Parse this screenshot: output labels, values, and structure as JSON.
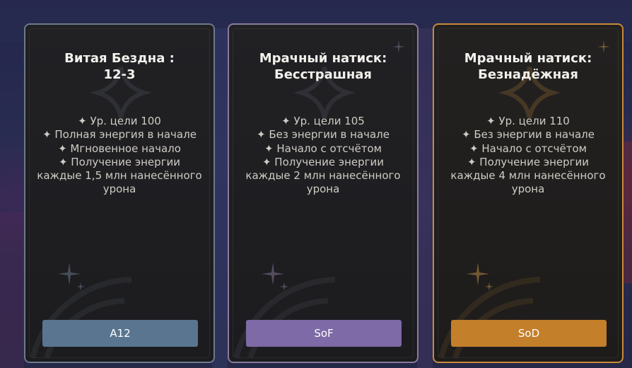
{
  "colors": {
    "a12_accent": "#5a7590",
    "sof_accent": "#7d6aa6",
    "sod_accent": "#c47f2a",
    "card_background": "#1e1e21",
    "title_text": "#f3f1ec",
    "rule_text": "#cfcbc4"
  },
  "cards": [
    {
      "id": "a12",
      "title": "Витая Бездна :\n12-3",
      "emblem_icon": "four-point-star-icon",
      "rules": [
        "✦ Ур. цели 100",
        "✦ Полная энергия в начале",
        "✦ Мгновенное начало",
        "✦ Получение энергии каждые 1,5 млн нанесённого урона"
      ],
      "button_label": "A12"
    },
    {
      "id": "sof",
      "title": "Мрачный натиск:\nБесстрашная",
      "emblem_icon": "four-point-star-icon",
      "rules": [
        "✦ Ур. цели 105",
        "✦ Без энергии в начале",
        "✦ Начало с отсчётом",
        "✦ Получение энергии каждые 2 млн нанесённого урона"
      ],
      "button_label": "SoF"
    },
    {
      "id": "sod",
      "title": "Мрачный натиск:\nБезнадёжная",
      "emblem_icon": "four-point-star-icon",
      "rules": [
        "✦ Ур. цели 110",
        "✦ Без энергии в начале",
        "✦ Начало с отсчётом",
        "✦ Получение энергии каждые 4 млн нанесённого урона"
      ],
      "button_label": "SoD"
    }
  ]
}
